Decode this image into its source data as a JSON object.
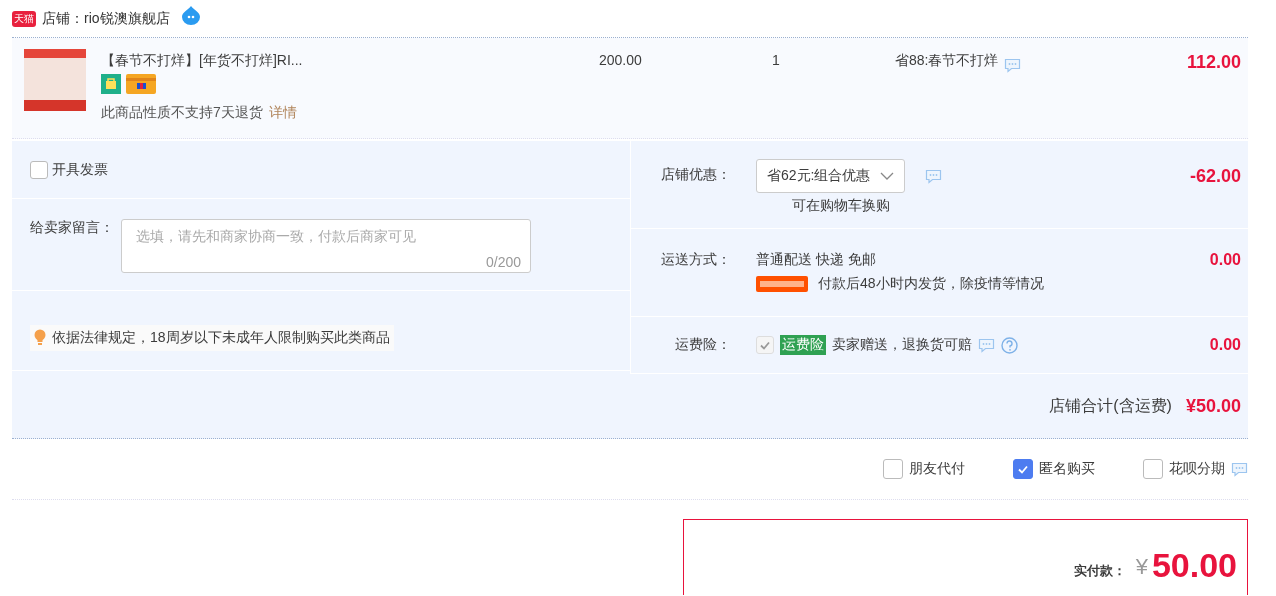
{
  "shop": {
    "logo": "天猫",
    "name": "店铺：rio锐澳旗舰店"
  },
  "item": {
    "title": "【春节不打烊】[年货不打烊]RI...",
    "return_note": "此商品性质不支持7天退货",
    "details_link": "详情",
    "price": "200.00",
    "quantity": "1",
    "discount": "省88:春节不打烊",
    "subtotal": "112.00"
  },
  "invoice": {
    "label": "开具发票",
    "checked": false
  },
  "message": {
    "label": "给卖家留言：",
    "placeholder": "选填，请先和商家协商一致，付款后商家可见",
    "counter": "0/200"
  },
  "notice": "依据法律规定，18周岁以下未成年人限制购买此类商品",
  "shop_discount": {
    "label": "店铺优惠：",
    "option": "省62元:组合优惠",
    "note": "可在购物车换购",
    "amount": "-62.00"
  },
  "shipping": {
    "label": "运送方式：",
    "method": "普通配送 快递 免邮",
    "note": "付款后48小时内发货，除疫情等情况",
    "amount": "0.00"
  },
  "insurance": {
    "label": "运费险：",
    "checked": true,
    "disabled": true,
    "tag": "运费险",
    "note": "卖家赠送，退换货可赔",
    "amount": "0.00"
  },
  "shop_total": {
    "label": "店铺合计(含运费)",
    "amount": "¥50.00"
  },
  "options": [
    {
      "label": "朋友代付",
      "checked": false,
      "has_info": false
    },
    {
      "label": "匿名购买",
      "checked": true,
      "has_info": false
    },
    {
      "label": "花呗分期",
      "checked": false,
      "has_info": true
    }
  ],
  "payment": {
    "label": "实付款：",
    "currency": "¥",
    "amount": "50.00"
  }
}
